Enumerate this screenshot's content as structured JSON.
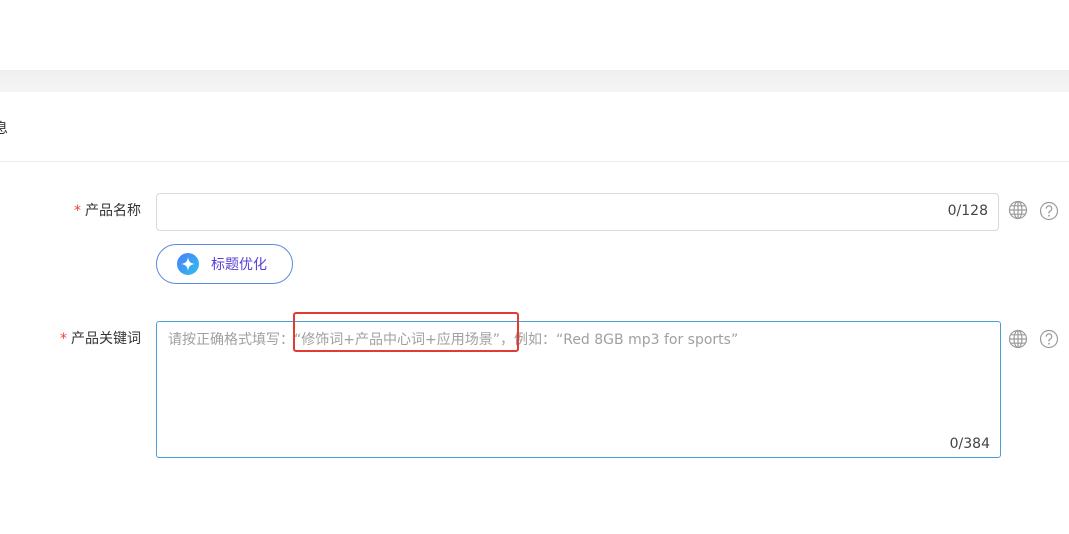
{
  "section": {
    "title": "息"
  },
  "form": {
    "product_name": {
      "required_mark": "*",
      "label": "产品名称",
      "value": "",
      "counter": "0/128"
    },
    "title_optimize_button": {
      "label": "标题优化"
    },
    "product_keywords": {
      "required_mark": "*",
      "label": "产品关键词",
      "placeholder": "请按正确格式填写：“修饰词+产品中心词+应用场景”，例如：“Red 8GB mp3 for sports”",
      "counter": "0/384"
    }
  },
  "icons": {
    "language": "globe-icon",
    "help": "question-icon",
    "optimize": "star-sparkle-icon"
  },
  "colors": {
    "required": "#f03b3b",
    "accent_border": "#4a9fd8",
    "button_text": "#5a3fd6",
    "annotation": "#e53935"
  }
}
